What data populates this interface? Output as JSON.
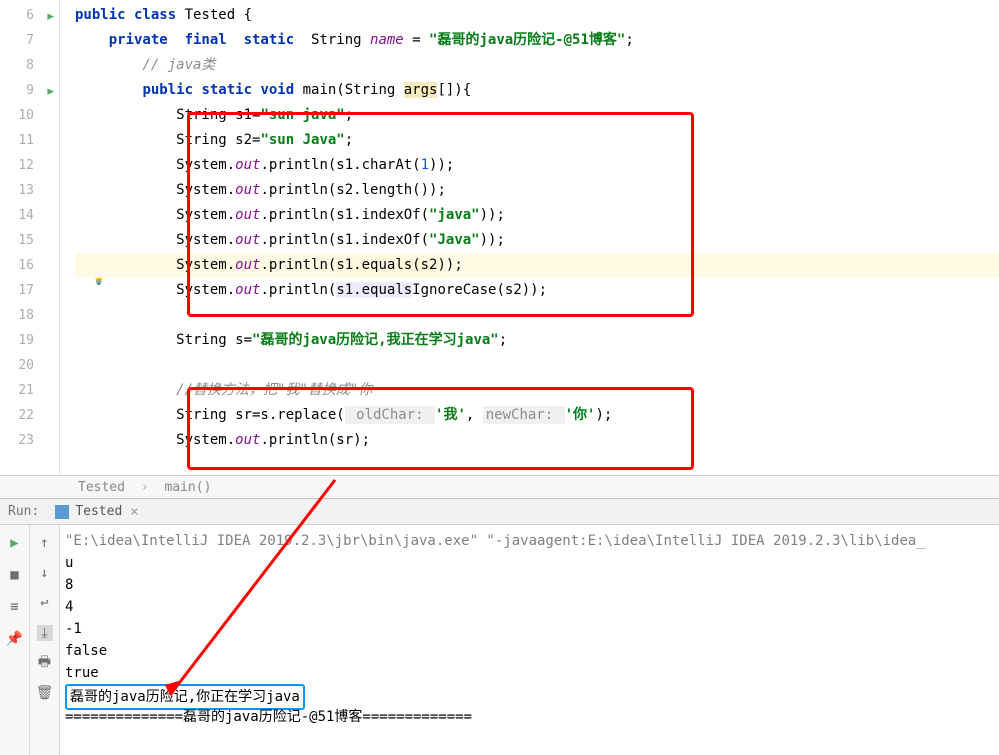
{
  "gutter": {
    "lines": [
      6,
      7,
      8,
      9,
      10,
      11,
      12,
      13,
      14,
      15,
      16,
      17,
      18,
      19,
      20,
      21,
      22,
      23
    ],
    "run_markers": [
      6,
      9
    ]
  },
  "code": {
    "l6": {
      "kw1": "public class",
      "name": " Tested {"
    },
    "l7": {
      "kw1": "private  final  static",
      "type": "  String ",
      "fld": "name",
      "eq": " = ",
      "str": "\"磊哥的java历险记-@51博客\"",
      "end": ";"
    },
    "l8": "        // java类",
    "l9": {
      "kw1": "public static void",
      "name": " main(String ",
      "args": "args",
      "rest": "[]){"
    },
    "l10": {
      "pre": "            String s1=",
      "str": "\"sun java\"",
      "end": ";"
    },
    "l11": {
      "pre": "            String s2=",
      "str": "\"sun Java\"",
      "end": ";"
    },
    "l12": {
      "pre": "            System.",
      "out": "out",
      "mid": ".println(s1.charAt(",
      "num": "1",
      "end": "));"
    },
    "l13": {
      "pre": "            System.",
      "out": "out",
      "end": ".println(s2.length());"
    },
    "l14": {
      "pre": "            System.",
      "out": "out",
      "mid": ".println(s1.indexOf(",
      "str": "\"java\"",
      "end": "));"
    },
    "l15": {
      "pre": "            System.",
      "out": "out",
      "mid": ".println(s1.indexOf(",
      "str": "\"Java\"",
      "end": "));"
    },
    "l16": {
      "pre": "            System.",
      "out": "out",
      "mid": ".println(",
      "sel": "s1.equals(s2)",
      "end": ");"
    },
    "l17": {
      "pre": "            System.",
      "out": "out",
      "mid1": ".println(",
      "sel": "s1.equals",
      "mid2": "IgnoreCase(s2));"
    },
    "l19": {
      "pre": "            String s=",
      "str": "\"磊哥的java历险记,我正在学习java\"",
      "end": ";"
    },
    "l21": "            //替换方法，把\"我\"替换成\"你",
    "l22": {
      "pre": "            String sr=s.replace(",
      "p1": " oldChar: ",
      "c1": "'我'",
      "comma": ", ",
      "p2": "newChar: ",
      "c2": "'你'",
      "end": ");"
    },
    "l23": {
      "pre": "            System.",
      "out": "out",
      "end": ".println(sr);"
    }
  },
  "breadcrumb": {
    "item1": "Tested",
    "item2": "main()"
  },
  "run": {
    "label": "Run:",
    "config": "Tested",
    "output": {
      "cmd": "\"E:\\idea\\IntelliJ IDEA 2019.2.3\\jbr\\bin\\java.exe\" \"-javaagent:E:\\idea\\IntelliJ IDEA 2019.2.3\\lib\\idea_",
      "l1": "u",
      "l2": "8",
      "l3": "4",
      "l4": "-1",
      "l5": "false",
      "l6": "true",
      "l7": "磊哥的java历险记,你正在学习java",
      "l8": "==============磊哥的java历险记-@51博客============="
    }
  }
}
